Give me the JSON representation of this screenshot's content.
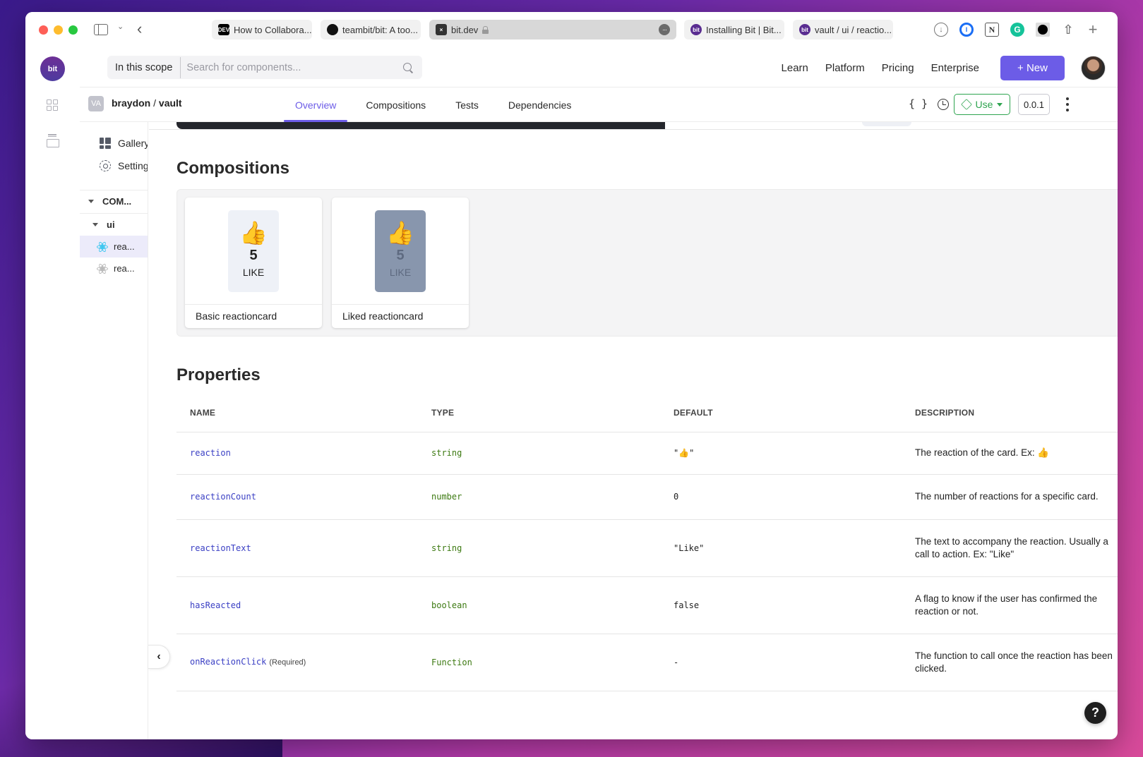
{
  "browser": {
    "tabs": [
      {
        "label": "How to Collabora...",
        "favicon": "DEV"
      },
      {
        "label": "teambit/bit: A too...",
        "favicon": "github-icon"
      },
      {
        "label": "bit.dev",
        "favicon": "x-icon",
        "active": true
      },
      {
        "label": "Installing Bit | Bit...",
        "favicon": "bit"
      },
      {
        "label": "vault / ui / reactio...",
        "favicon": "bit"
      }
    ],
    "more_label": "···"
  },
  "header": {
    "logo_text": "bit",
    "scope_label": "In this scope",
    "search_placeholder": "Search for components...",
    "nav": [
      "Learn",
      "Platform",
      "Pricing",
      "Enterprise"
    ],
    "new_button": "+ New"
  },
  "component_bar": {
    "scope_badge": "VA",
    "owner": "braydon",
    "separator": " / ",
    "scope": "vault",
    "tabs": [
      {
        "label": "Overview",
        "active": true
      },
      {
        "label": "Compositions",
        "active": false
      },
      {
        "label": "Tests",
        "active": false
      },
      {
        "label": "Dependencies",
        "active": false
      }
    ],
    "code_icon_label": "{ }",
    "use_label": "Use",
    "version": "0.0.1"
  },
  "side_panel": {
    "gallery": "Gallery",
    "settings": "Settings",
    "tree": {
      "root": "COM...",
      "folder": "ui",
      "items": [
        "rea...",
        "rea..."
      ]
    }
  },
  "compositions": {
    "title": "Compositions",
    "cards": [
      {
        "caption": "Basic reactioncard",
        "emoji": "👍",
        "count": "5",
        "label": "LIKE",
        "liked": false
      },
      {
        "caption": "Liked reactioncard",
        "emoji": "👍",
        "count": "5",
        "label": "LIKE",
        "liked": true
      }
    ]
  },
  "properties": {
    "title": "Properties",
    "columns": [
      "NAME",
      "TYPE",
      "DEFAULT",
      "DESCRIPTION"
    ],
    "rows": [
      {
        "name": "reaction",
        "required": "",
        "type": "string",
        "default": "\"👍\"",
        "description": "The reaction of the card. Ex: 👍"
      },
      {
        "name": "reactionCount",
        "required": "",
        "type": "number",
        "default": "0",
        "description": "The number of reactions for a specific card."
      },
      {
        "name": "reactionText",
        "required": "",
        "type": "string",
        "default": "\"Like\"",
        "description": "The text to accompany the reaction. Usually a call to action. Ex: \"Like\""
      },
      {
        "name": "hasReacted",
        "required": "",
        "type": "boolean",
        "default": "false",
        "description": "A flag to know if the user has confirmed the reaction or not."
      },
      {
        "name": "onReactionClick",
        "required": "(Required)",
        "type": "Function",
        "default": "-",
        "description": "The function to call once the reaction has been clicked."
      }
    ]
  },
  "help_label": "?"
}
